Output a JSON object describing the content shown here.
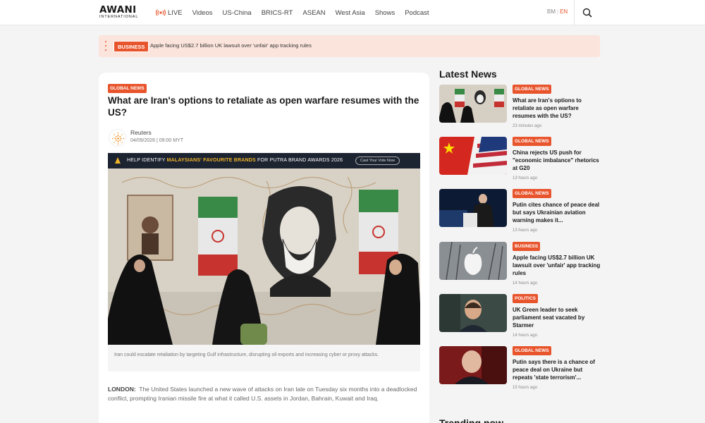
{
  "header": {
    "logo_main": "AWANI",
    "logo_sub": "INTERNATIONAL",
    "nav": [
      "LIVE",
      "Videos",
      "US-China",
      "BRICS-RT",
      "ASEAN",
      "West Asia",
      "Shows",
      "Podcast"
    ],
    "lang_bm": "BM",
    "lang_en": "EN",
    "lang_sep": "|"
  },
  "ticker": {
    "badge": "BUSINESS",
    "text": "Apple facing US$2.7 billion UK lawsuit over 'unfair' app tracking rules"
  },
  "article": {
    "category": "GLOBAL NEWS",
    "title": "What are Iran's options to retaliate as open warfare resumes with the US?",
    "author": "Reuters",
    "date": "04/09/2026 | 09:00 MYT",
    "banner_pre": "HELP IDENTIFY ",
    "banner_highlight": "MALAYSIANS' FAVOURITE BRANDS",
    "banner_post": " FOR PUTRA BRAND AWARDS 2026",
    "banner_button": "Cast Your Vote Now",
    "caption": "Iran could escalate retaliation by targeting Gulf infrastructure, disrupting oil exports and increasing cyber or proxy attacks.",
    "body_dateline": "LONDON:",
    "body_text": "The United States launched a new wave of attacks on Iran late on Tuesday six months into a deadlocked conflict, prompting Iranian missile fire at what it called U.S. assets in Jordan, Bahrain, Kuwait and Iraq."
  },
  "latest": {
    "title": "Latest News",
    "items": [
      {
        "category": "GLOBAL NEWS",
        "headline": "What are Iran's options to retaliate as open warfare resumes with the US?",
        "time": "23 minutes ago",
        "thumb": "iran-mural"
      },
      {
        "category": "GLOBAL NEWS",
        "headline": "China rejects US push for \"economic imbalance\" rhetorics at G20",
        "time": "13 hours ago",
        "thumb": "china-us-flags"
      },
      {
        "category": "GLOBAL NEWS",
        "headline": "Putin cites chance of peace deal but says Ukrainian aviation warning makes it...",
        "time": "13 hours ago",
        "thumb": "putin-podium"
      },
      {
        "category": "BUSINESS",
        "headline": "Apple facing US$2.7 billion UK lawsuit over 'unfair' app tracking rules",
        "time": "14 hours ago",
        "thumb": "apple-logo"
      },
      {
        "category": "POLITICS",
        "headline": "UK Green leader to seek parliament seat vacated by Starmer",
        "time": "14 hours ago",
        "thumb": "green-leader"
      },
      {
        "category": "GLOBAL NEWS",
        "headline": "Putin says there is a chance of peace deal on Ukraine but repeats 'state terrorism'...",
        "time": "15 hours ago",
        "thumb": "putin-portrait"
      }
    ]
  },
  "trending_title": "Trending now",
  "colors": {
    "accent": "#e8542c",
    "ticker_bg": "#fbe4dc",
    "page_bg": "#f4f4f4"
  }
}
